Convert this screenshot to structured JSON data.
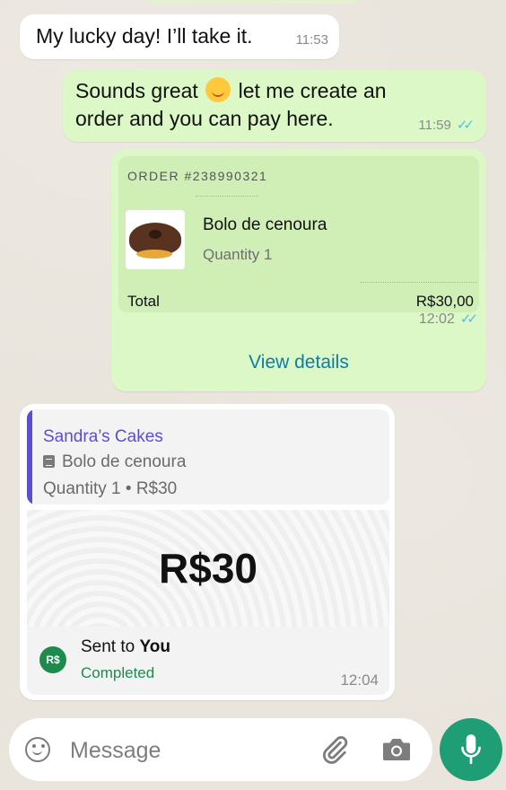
{
  "messages": {
    "m1": {
      "text": "My lucky day! I’ll take it.",
      "time": "11:53"
    },
    "m2": {
      "text_before": "Sounds great",
      "text_after": "let me create an order and you can pay here.",
      "time": "11:59"
    }
  },
  "order": {
    "number": "ORDER #238990321",
    "product_name": "Bolo de cenoura",
    "quantity": "Quantity 1",
    "total_label": "Total",
    "total_value": "R$30,00",
    "time": "12:02",
    "view_details": "View details"
  },
  "payment": {
    "merchant": "Sandra’s Cakes",
    "item": "Bolo de cenoura",
    "qty_price": "Quantity 1 • R$30",
    "amount": "R$30",
    "badge": "R$",
    "sent_prefix": "Sent to ",
    "sent_to": "You",
    "status": "Completed",
    "time": "12:04"
  },
  "composer": {
    "placeholder": "Message"
  },
  "colors": {
    "outgoing": "#dcf8c6",
    "incoming": "#ffffff",
    "read_ticks": "#53bdeb",
    "link": "#0a7eaa",
    "merchant": "#5a4fd0",
    "success": "#1e8a4e",
    "mic_button": "#1f9d74"
  },
  "icons": {
    "emoji": "smiling-face-icon",
    "ticks": "double-check-icon",
    "doc": "document-icon",
    "attach": "paperclip-icon",
    "camera": "camera-icon",
    "mic": "microphone-icon",
    "emoji_picker": "smile-icon"
  }
}
